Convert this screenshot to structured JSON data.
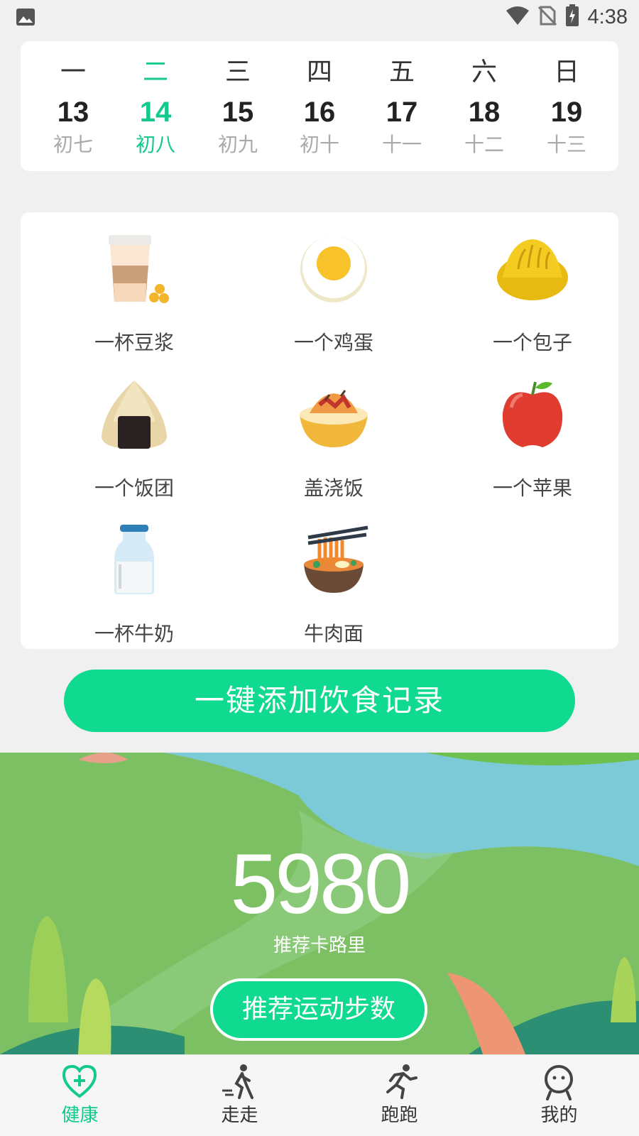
{
  "status_bar": {
    "time": "4:38",
    "icons": [
      "image-icon",
      "wifi-icon",
      "no-sim-icon",
      "battery-charging-icon"
    ]
  },
  "calendar": {
    "days": [
      {
        "weekday": "一",
        "date": "13",
        "lunar": "初七",
        "active": false
      },
      {
        "weekday": "二",
        "date": "14",
        "lunar": "初八",
        "active": true
      },
      {
        "weekday": "三",
        "date": "15",
        "lunar": "初九",
        "active": false
      },
      {
        "weekday": "四",
        "date": "16",
        "lunar": "初十",
        "active": false
      },
      {
        "weekday": "五",
        "date": "17",
        "lunar": "十一",
        "active": false
      },
      {
        "weekday": "六",
        "date": "18",
        "lunar": "十二",
        "active": false
      },
      {
        "weekday": "日",
        "date": "19",
        "lunar": "十三",
        "active": false
      }
    ]
  },
  "foods": [
    {
      "label": "一杯豆浆",
      "icon": "soy-milk-icon"
    },
    {
      "label": "一个鸡蛋",
      "icon": "egg-icon"
    },
    {
      "label": "一个包子",
      "icon": "bun-icon"
    },
    {
      "label": "一个饭团",
      "icon": "rice-ball-icon"
    },
    {
      "label": "盖浇饭",
      "icon": "rice-bowl-icon"
    },
    {
      "label": "一个苹果",
      "icon": "apple-icon"
    },
    {
      "label": "一杯牛奶",
      "icon": "milk-icon"
    },
    {
      "label": "牛肉面",
      "icon": "beef-noodles-icon"
    }
  ],
  "add_button_label": "一键添加饮食记录",
  "recommend": {
    "calories": "5980",
    "calories_label": "推荐卡路里",
    "steps_button_label": "推荐运动步数"
  },
  "bottom_nav": [
    {
      "label": "健康",
      "icon": "heart-plus-icon",
      "active": true
    },
    {
      "label": "走走",
      "icon": "walking-icon",
      "active": false
    },
    {
      "label": "跑跑",
      "icon": "running-icon",
      "active": false
    },
    {
      "label": "我的",
      "icon": "profile-icon",
      "active": false
    }
  ],
  "colors": {
    "accent": "#10d990",
    "accent_text": "#13c98d"
  }
}
